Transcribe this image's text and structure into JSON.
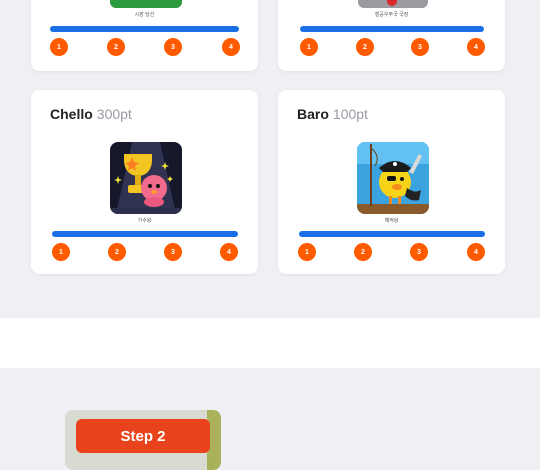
{
  "cards_top": [
    {
      "caption": "시장 당선",
      "steps": [
        "1",
        "2",
        "3",
        "4"
      ]
    },
    {
      "caption": "철공우주국 국장",
      "steps": [
        "1",
        "2",
        "3",
        "4"
      ]
    }
  ],
  "cards_bottom": [
    {
      "name": "Chello",
      "points": "300pt",
      "caption": "가수왕",
      "steps": [
        "1",
        "2",
        "3",
        "4"
      ]
    },
    {
      "name": "Baro",
      "points": "100pt",
      "caption": "해적왕",
      "steps": [
        "1",
        "2",
        "3",
        "4"
      ]
    }
  ],
  "step_card": {
    "label": "Step 2"
  },
  "colors": {
    "accent_blue": "#1a6fe6",
    "step_orange": "#ff5a00",
    "banner_red": "#e8431c"
  }
}
